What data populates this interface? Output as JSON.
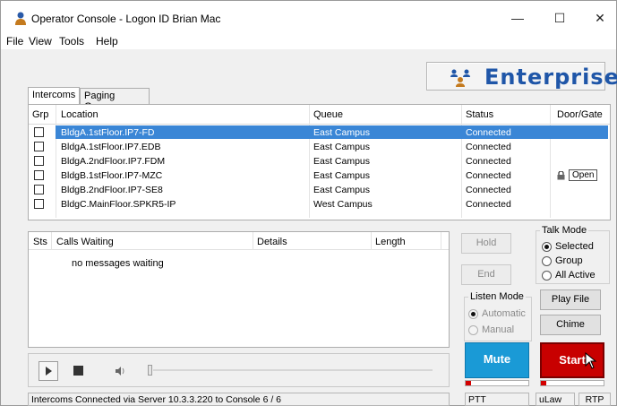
{
  "window": {
    "title": "Operator Console - Logon ID Brian Mac",
    "controls": {
      "minimize": "—",
      "maximize": "☐",
      "close": "✕"
    }
  },
  "menu": [
    "File",
    "View",
    "Tools",
    "Help"
  ],
  "logo": {
    "text": "Enterprise",
    "color": "#1f56a8"
  },
  "tabs": [
    {
      "label": "Intercoms",
      "active": true
    },
    {
      "label": "Paging Groups",
      "active": false
    }
  ],
  "intercoms": {
    "columns": {
      "grp": "Grp",
      "location": "Location",
      "queue": "Queue",
      "status": "Status",
      "door": "Door/Gate"
    },
    "rows": [
      {
        "location": "BldgA.1stFloor.IP7-FD",
        "queue": "East Campus",
        "status": "Connected",
        "door": "",
        "selected": true
      },
      {
        "location": "BldgA.1stFloor.IP7.EDB",
        "queue": "East Campus",
        "status": "Connected",
        "door": "",
        "selected": false
      },
      {
        "location": "BldgA.2ndFloor.IP7.FDM",
        "queue": "East Campus",
        "status": "Connected",
        "door": "",
        "selected": false
      },
      {
        "location": "BldgB.1stFloor.IP7-MZC",
        "queue": "East Campus",
        "status": "Connected",
        "door": "Open",
        "selected": false
      },
      {
        "location": "BldgB.2ndFloor.IP7-SE8",
        "queue": "East Campus",
        "status": "Connected",
        "door": "",
        "selected": false
      },
      {
        "location": "BldgC.MainFloor.SPKR5-IP",
        "queue": "West Campus",
        "status": "Connected",
        "door": "",
        "selected": false
      }
    ],
    "selected_color": "#3a86d6"
  },
  "calls": {
    "columns": {
      "sts": "Sts",
      "waiting": "Calls Waiting",
      "details": "Details",
      "length": "Length"
    },
    "empty_text": "no messages waiting"
  },
  "controls": {
    "hold": "Hold",
    "end": "End",
    "play_file": "Play File",
    "chime": "Chime",
    "mute": "Mute",
    "start": "Start",
    "mute_color": "#1a9ad6",
    "start_color": "#c80000",
    "talk_mode": {
      "title": "Talk Mode",
      "options": [
        "Selected",
        "Group",
        "All Active"
      ],
      "selected": "Selected"
    },
    "listen_mode": {
      "title": "Listen Mode",
      "options": [
        "Automatic",
        "Manual"
      ],
      "selected": "Automatic"
    }
  },
  "status": {
    "message": "Intercoms Connected via Server 10.3.3.220 to Console 6 / 6",
    "ptt": "PTT",
    "codec": "uLaw",
    "transport": "RTP"
  }
}
